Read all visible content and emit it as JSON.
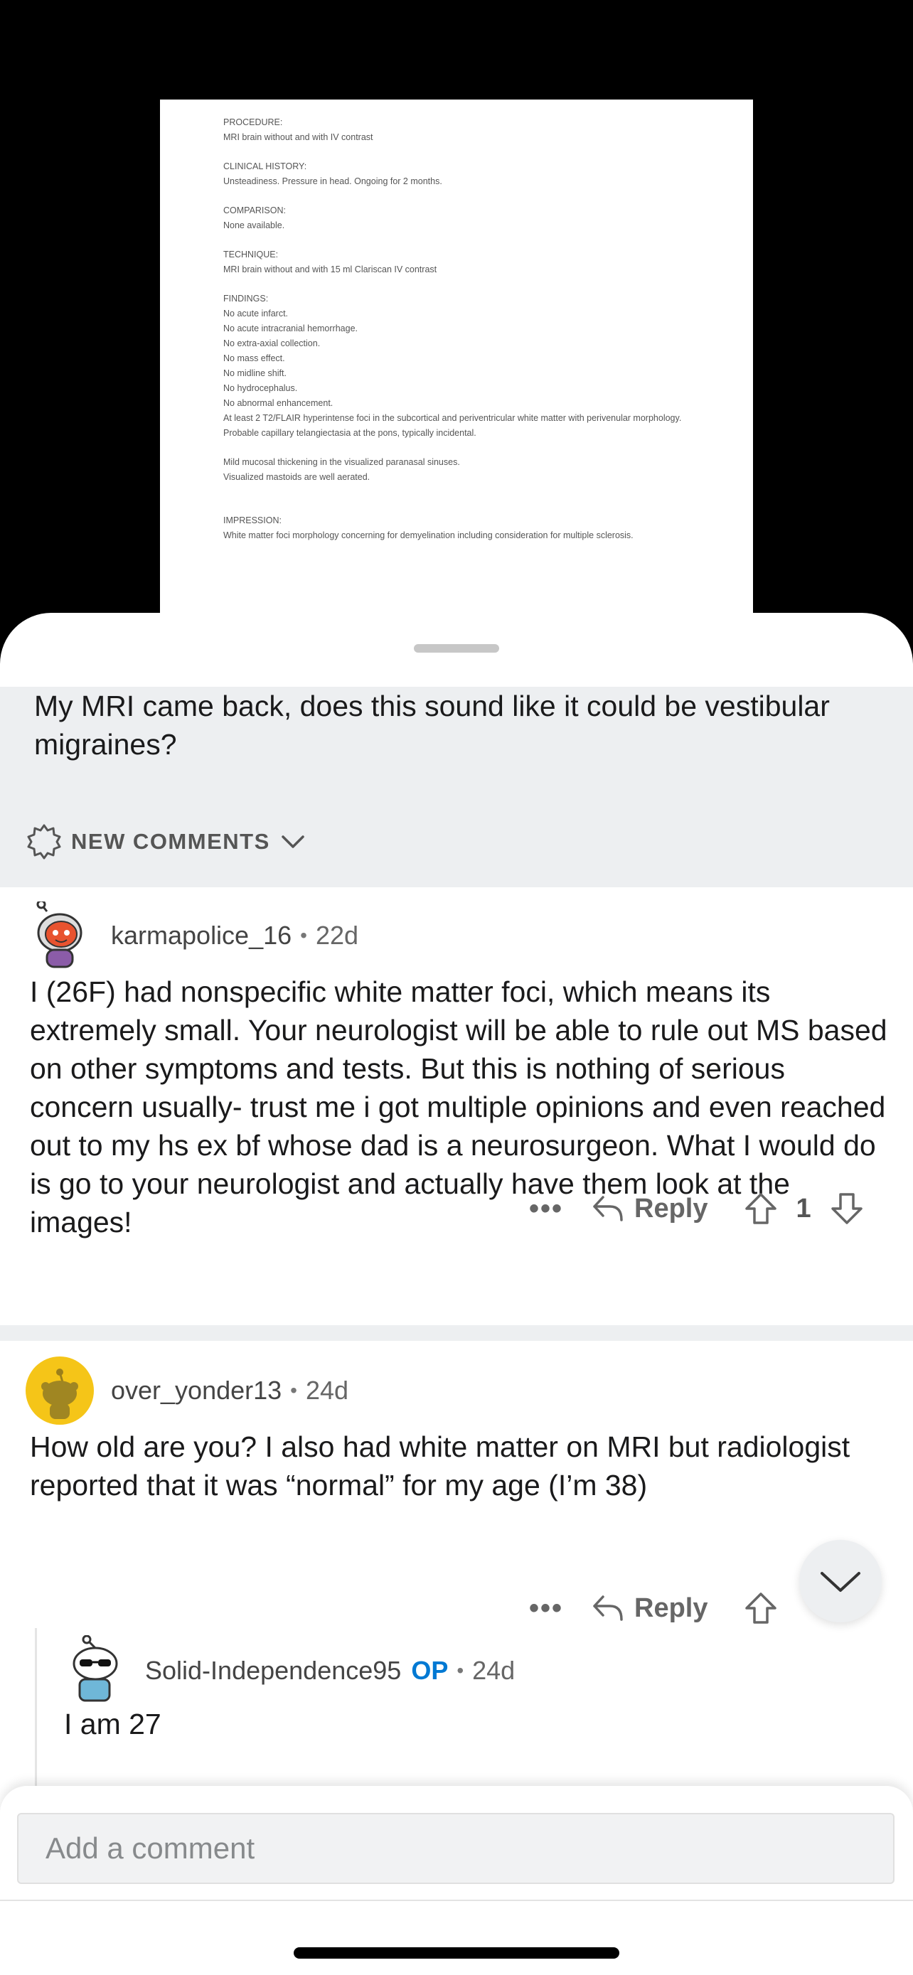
{
  "document": {
    "sections": [
      {
        "heading": "PROCEDURE:",
        "lines": [
          "MRI brain without and with IV contrast"
        ]
      },
      {
        "heading": "CLINICAL HISTORY:",
        "lines": [
          "Unsteadiness. Pressure in head. Ongoing for 2 months."
        ]
      },
      {
        "heading": "COMPARISON:",
        "lines": [
          "None available."
        ]
      },
      {
        "heading": "TECHNIQUE:",
        "lines": [
          "MRI brain without and with 15 ml Clariscan IV contrast"
        ]
      },
      {
        "heading": "FINDINGS:",
        "lines": [
          "No acute infarct.",
          "No acute intracranial hemorrhage.",
          "No extra-axial collection.",
          "No mass effect.",
          "No midline shift.",
          "No hydrocephalus.",
          "No abnormal enhancement.",
          "At least 2 T2/FLAIR hyperintense foci in the subcortical and periventricular white matter with perivenular morphology.",
          "Probable capillary telangiectasia at the pons, typically incidental."
        ]
      },
      {
        "heading": "",
        "lines": [
          "Mild mucosal thickening in the visualized paranasal sinuses.",
          "Visualized mastoids are well aerated."
        ]
      },
      {
        "heading": "IMPRESSION:",
        "lines": [
          "White matter foci morphology concerning for demyelination including consideration for multiple sclerosis."
        ]
      }
    ]
  },
  "post": {
    "title": "My MRI came back, does this sound like it could be vestibular migraines?"
  },
  "new_comments": {
    "label": "NEW COMMENTS",
    "icon": "sparkle-badge-icon"
  },
  "comments": [
    {
      "user": "karmapolice_16",
      "age": "22d",
      "body": "I (26F) had nonspecific white matter foci, which means its extremely small. Your neurologist will be able to rule out MS based on other symptoms and tests. But this is nothing of serious concern usually- trust me i got multiple opinions and even reached out to my hs ex bf whose dad is a neurosurgeon. What I would do is go to your neurologist and actually have them look at the images!",
      "reply_label": "Reply",
      "votes": "1",
      "more": "•••"
    },
    {
      "user": "over_yonder13",
      "age": "24d",
      "body": "How old are you? I also had white matter on MRI but radiologist reported that it was “normal” for my age (I’m 38)",
      "reply_label": "Reply",
      "more": "•••"
    },
    {
      "user": "Solid-Independence95",
      "op_badge": "OP",
      "age": "24d",
      "body": "I am 27"
    }
  ],
  "dot_separator": "•",
  "comment_input": {
    "placeholder": "Add a comment"
  },
  "colors": {
    "accent": "#0079d3",
    "sheet_gray": "#edeff1"
  }
}
